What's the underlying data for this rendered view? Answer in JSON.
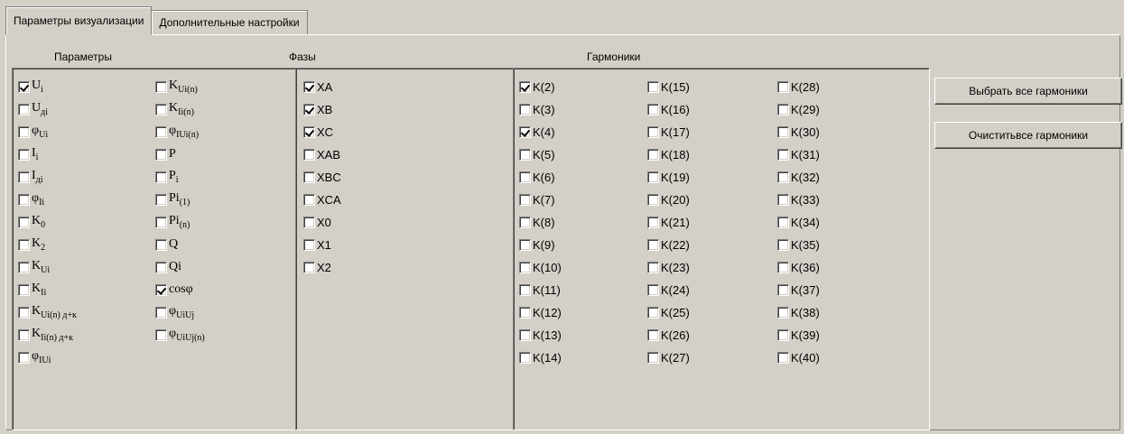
{
  "tabs": [
    {
      "label": "Параметры визуализации",
      "active": true
    },
    {
      "label": "Дополнительные настройки",
      "active": false
    }
  ],
  "sections": {
    "params_title": "Параметры",
    "phases_title": "Фазы",
    "harmonics_title": "Гармоники"
  },
  "params": {
    "col1": [
      {
        "main": "U",
        "sub": "i",
        "checked": true
      },
      {
        "main": "U",
        "sub": "дi",
        "checked": false
      },
      {
        "main": "φ",
        "sub": "Ui",
        "checked": false
      },
      {
        "main": "I",
        "sub": "i",
        "checked": false
      },
      {
        "main": "I",
        "sub": "дi",
        "checked": false
      },
      {
        "main": "φ",
        "sub": "Ii",
        "checked": false
      },
      {
        "main": "K",
        "sub": "0",
        "checked": false
      },
      {
        "main": "K",
        "sub": "2",
        "checked": false
      },
      {
        "main": "K",
        "sub": "Ui",
        "checked": false
      },
      {
        "main": "K",
        "sub": "Ii",
        "checked": false
      },
      {
        "main": "K",
        "sub": "Ui(n) д+к",
        "checked": false
      },
      {
        "main": "K",
        "sub": "Ii(n) д+к",
        "checked": false
      },
      {
        "main": "φ",
        "sub": "IUi",
        "checked": false
      }
    ],
    "col2": [
      {
        "main": "K",
        "sub": "Ui(n)",
        "checked": false
      },
      {
        "main": "K",
        "sub": "Ii(n)",
        "checked": false
      },
      {
        "main": "φ",
        "sub": "IUi(n)",
        "checked": false
      },
      {
        "main": "P",
        "sub": "",
        "checked": false
      },
      {
        "main": "P",
        "sub": "i",
        "checked": false
      },
      {
        "main": "Pi",
        "sub": "(1)",
        "checked": false
      },
      {
        "main": "Pi",
        "sub": "(n)",
        "checked": false
      },
      {
        "main": "Q",
        "sub": "",
        "checked": false
      },
      {
        "main": "Qi",
        "sub": "",
        "checked": false
      },
      {
        "main": "cosφ",
        "sub": "",
        "checked": true
      },
      {
        "main": "φ",
        "sub": "UiUj",
        "checked": false
      },
      {
        "main": "φ",
        "sub": "UiUj(n)",
        "checked": false
      }
    ]
  },
  "phases": [
    {
      "label": "XA",
      "checked": true
    },
    {
      "label": "XB",
      "checked": true
    },
    {
      "label": "XC",
      "checked": true
    },
    {
      "label": "XAB",
      "checked": false
    },
    {
      "label": "XBC",
      "checked": false
    },
    {
      "label": "XCA",
      "checked": false
    },
    {
      "label": "X0",
      "checked": false
    },
    {
      "label": "X1",
      "checked": false
    },
    {
      "label": "X2",
      "checked": false
    }
  ],
  "harmonics": {
    "col1": [
      {
        "label": "K(2)",
        "checked": true
      },
      {
        "label": "K(3)",
        "checked": false
      },
      {
        "label": "K(4)",
        "checked": true
      },
      {
        "label": "K(5)",
        "checked": false
      },
      {
        "label": "K(6)",
        "checked": false
      },
      {
        "label": "K(7)",
        "checked": false
      },
      {
        "label": "K(8)",
        "checked": false
      },
      {
        "label": "K(9)",
        "checked": false
      },
      {
        "label": "K(10)",
        "checked": false
      },
      {
        "label": "K(11)",
        "checked": false
      },
      {
        "label": "K(12)",
        "checked": false
      },
      {
        "label": "K(13)",
        "checked": false
      },
      {
        "label": "K(14)",
        "checked": false
      }
    ],
    "col2": [
      {
        "label": "K(15)",
        "checked": false
      },
      {
        "label": "K(16)",
        "checked": false
      },
      {
        "label": "K(17)",
        "checked": false
      },
      {
        "label": "K(18)",
        "checked": false
      },
      {
        "label": "K(19)",
        "checked": false
      },
      {
        "label": "K(20)",
        "checked": false
      },
      {
        "label": "K(21)",
        "checked": false
      },
      {
        "label": "K(22)",
        "checked": false
      },
      {
        "label": "K(23)",
        "checked": false
      },
      {
        "label": "K(24)",
        "checked": false
      },
      {
        "label": "K(25)",
        "checked": false
      },
      {
        "label": "K(26)",
        "checked": false
      },
      {
        "label": "K(27)",
        "checked": false
      }
    ],
    "col3": [
      {
        "label": "K(28)",
        "checked": false
      },
      {
        "label": "K(29)",
        "checked": false
      },
      {
        "label": "K(30)",
        "checked": false
      },
      {
        "label": "K(31)",
        "checked": false
      },
      {
        "label": "K(32)",
        "checked": false
      },
      {
        "label": "K(33)",
        "checked": false
      },
      {
        "label": "K(34)",
        "checked": false
      },
      {
        "label": "K(35)",
        "checked": false
      },
      {
        "label": "K(36)",
        "checked": false
      },
      {
        "label": "K(37)",
        "checked": false
      },
      {
        "label": "K(38)",
        "checked": false
      },
      {
        "label": "K(39)",
        "checked": false
      },
      {
        "label": "K(40)",
        "checked": false
      }
    ]
  },
  "buttons": {
    "select_all": "Выбрать все гармоники",
    "clear_all": "Очиститьвсе гармоники"
  }
}
